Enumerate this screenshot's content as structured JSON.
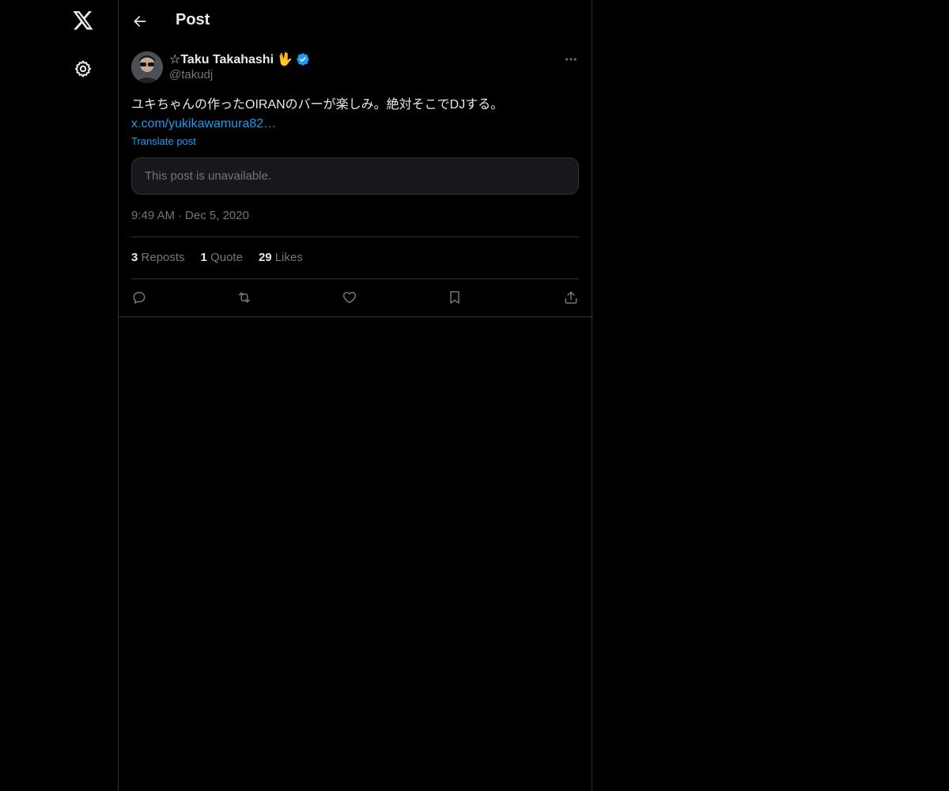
{
  "header": {
    "title": "Post"
  },
  "post": {
    "author": {
      "display_name": "☆Taku Takahashi",
      "emoji": "🖖",
      "handle": "@takudj",
      "verified": true
    },
    "text": "ユキちゃんの作ったOIRANのバーが楽しみ。絶対そこでDJする。",
    "link": "x.com/yukikawamura82…",
    "translate_label": "Translate post",
    "unavailable_text": "This post is unavailable.",
    "time": "9:49 AM",
    "separator": "·",
    "date": "Dec 5, 2020",
    "stats": {
      "reposts_count": "3",
      "reposts_label": "Reposts",
      "quotes_count": "1",
      "quotes_label": "Quote",
      "likes_count": "29",
      "likes_label": "Likes"
    }
  },
  "colors": {
    "background": "#000000",
    "accent": "#1d9bf0",
    "text_primary": "#e7e9ea",
    "text_secondary": "#71767b",
    "border": "#2f3336"
  },
  "icons": {
    "logo": "x-logo-icon",
    "settings": "gear-icon",
    "back": "arrow-left-icon",
    "more": "more-horizontal-icon",
    "verified": "verified-badge-icon",
    "reply": "reply-icon",
    "repost": "repost-icon",
    "like": "heart-icon",
    "bookmark": "bookmark-icon",
    "share": "share-icon"
  }
}
